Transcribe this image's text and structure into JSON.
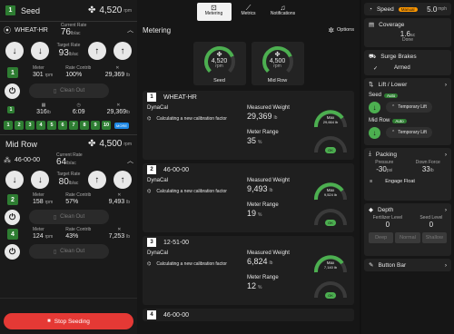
{
  "left": {
    "seed_header": {
      "badge": "1",
      "title": "Seed",
      "rpm_value": "4,520",
      "rpm_unit": "rpm"
    },
    "wheat": {
      "label": "WHEAT-HR",
      "current_rate_label": "Current Rate",
      "current_rate_value": "76",
      "current_rate_unit": "lb/ac",
      "target_rate_label": "Target Rate",
      "target_rate_value": "93",
      "target_rate_unit": "lb/ac",
      "meter_label": "Meter",
      "meter_value": "301",
      "meter_unit": "rpm",
      "contrib_label": "Rate Contrib",
      "contrib_value": "100%",
      "fan_value": "29,369",
      "fan_unit": "lb",
      "badge_a": "1",
      "badge_b": "1",
      "clean_out": "Clean Out",
      "stats_badge": "1",
      "stat1_value": "316",
      "stat1_unit": "lb",
      "stat2_value": "6:09",
      "stat3_value": "29,369",
      "stat3_unit": "lb"
    },
    "rows_strip": [
      "1",
      "2",
      "3",
      "4",
      "5",
      "6",
      "7",
      "8",
      "9",
      "10"
    ],
    "rows_strip_more": "MORE",
    "midrow_header": {
      "title": "Mid Row",
      "rpm_value": "4,500",
      "rpm_unit": "rpm"
    },
    "mid": {
      "label": "46-00-00",
      "current_rate_label": "Current Rate",
      "current_rate_value": "64",
      "current_rate_unit": "lb/ac",
      "target_rate_label": "Target Rate",
      "target_rate_value": "80",
      "target_rate_unit": "lb/ac",
      "m2": {
        "badge": "2",
        "meter_label": "Meter",
        "meter_value": "158",
        "meter_unit": "rpm",
        "contrib_label": "Rate Contrib",
        "contrib_value": "57%",
        "fan_value": "9,493",
        "fan_unit": "lb",
        "badge_b": "2"
      },
      "m4": {
        "badge": "4",
        "meter_label": "Meter",
        "meter_value": "124",
        "meter_unit": "rpm",
        "contrib_label": "Rate Contrib",
        "contrib_value": "43%",
        "fan_value": "7,253",
        "fan_unit": "lb",
        "badge_b": "4"
      },
      "clean_out": "Clean Out"
    },
    "stop_button": "Stop Seeding"
  },
  "tabs": [
    {
      "label": "Metering",
      "icon": "metering-icon",
      "active": true
    },
    {
      "label": "Metrics",
      "icon": "metrics-icon",
      "active": false
    },
    {
      "label": "Notifications",
      "icon": "bell-icon",
      "active": false
    }
  ],
  "metering": {
    "title": "Metering",
    "options_label": "Options",
    "fans": [
      {
        "value": "4,520",
        "unit": "rpm",
        "label": "Seed",
        "fill": 0.75
      },
      {
        "value": "4,500",
        "unit": "rpm",
        "label": "Mid Row",
        "fill": 0.75
      }
    ],
    "products": [
      {
        "num": "1",
        "name": "WHEAT-HR",
        "dynacal": "DynaCal",
        "calib": "Calculating a new calibration factor",
        "mw_label": "Measured Weight",
        "mw_value": "29,369",
        "mw_unit": "lb",
        "mr_label": "Meter Range",
        "mr_value": "35",
        "mr_unit": "%",
        "gauge_max": "Max",
        "gauge_value": "29,664 lb",
        "gauge_ok": "OK"
      },
      {
        "num": "2",
        "name": "46-00-00",
        "dynacal": "DynaCal",
        "calib": "Calculating a new calibration factor",
        "mw_label": "Measured Weight",
        "mw_value": "9,493",
        "mw_unit": "lb",
        "mr_label": "Meter Range",
        "mr_value": "19",
        "mr_unit": "%",
        "gauge_max": "Max",
        "gauge_value": "9,524 lb",
        "gauge_ok": "OK"
      },
      {
        "num": "3",
        "name": "12-51-00",
        "dynacal": "DynaCal",
        "calib": "Calculating a new calibration factor",
        "mw_label": "Measured Weight",
        "mw_value": "6,824",
        "mw_unit": "lb",
        "mr_label": "Meter Range",
        "mr_value": "12",
        "mr_unit": "%",
        "gauge_max": "Max",
        "gauge_value": "7,140 lb",
        "gauge_ok": "OK"
      },
      {
        "num": "4",
        "name": "46-00-00"
      }
    ]
  },
  "right": {
    "speed": {
      "label": "Speed",
      "badge": "Manual",
      "value": "5.0",
      "unit": "mph"
    },
    "coverage": {
      "label": "Coverage",
      "value": "1.6",
      "unit": "ac",
      "sub": "Done"
    },
    "surge": {
      "label": "Surge Brakes",
      "status": "Armed"
    },
    "lift": {
      "label": "Lift / Lower",
      "seed_label": "Seed",
      "seed_badge": "Auto",
      "seed_action": "Temporary Lift",
      "mid_label": "Mid Row",
      "mid_badge": "Auto",
      "mid_action": "Temporary Lift"
    },
    "packing": {
      "label": "Packing",
      "pressure_label": "Pressure",
      "pressure_value": "-30",
      "pressure_unit": "psi",
      "down_label": "Down Force",
      "down_value": "33",
      "down_unit": "lb",
      "float_action": "Engage Float"
    },
    "depth": {
      "label": "Depth",
      "fert_label": "Fertilizer Level",
      "fert_value": "0",
      "seed_label": "Seed Level",
      "seed_value": "0",
      "seg": [
        "Deep",
        "Normal",
        "Shallow"
      ]
    },
    "buttonbar": {
      "label": "Button Bar"
    }
  },
  "colors": {
    "green": "#4caf50",
    "dark_green": "#2e7d32",
    "red": "#d32f2f",
    "orange": "#ff9800"
  }
}
